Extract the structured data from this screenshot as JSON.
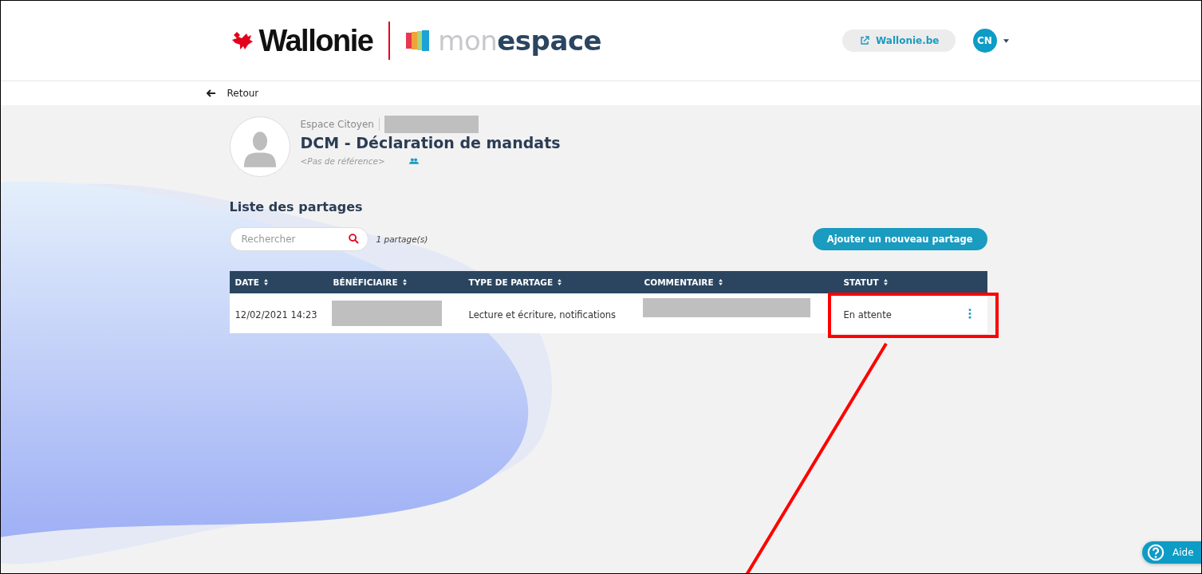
{
  "header": {
    "logo_primary": "Wallonie",
    "logo_secondary": "mon**espace**",
    "external_link": "Wallonie.be",
    "user_initials": "CN"
  },
  "back_link": "Retour",
  "profile": {
    "space": "Espace Citoyen",
    "name_redacted": true,
    "title": "DCM - Déclaration de mandats",
    "reference": "<Pas de référence>"
  },
  "section_title": "Liste des partages",
  "search": {
    "placeholder": "Rechercher"
  },
  "count": "1 partage(s)",
  "add_button": "Ajouter un nouveau partage",
  "table": {
    "columns": [
      "DATE",
      "BÉNÉFICIAIRE",
      "TYPE DE PARTAGE",
      "COMMENTAIRE",
      "STATUT"
    ],
    "rows": [
      {
        "cells": [
          {
            "kind": "text",
            "text": "12/02/2021 14:23"
          },
          {
            "kind": "redacted"
          },
          {
            "kind": "text",
            "text": "Lecture et écriture, notifications"
          },
          {
            "kind": "redacted"
          },
          {
            "kind": "text",
            "text": "En attente"
          }
        ]
      }
    ]
  },
  "help_button": "Aide"
}
